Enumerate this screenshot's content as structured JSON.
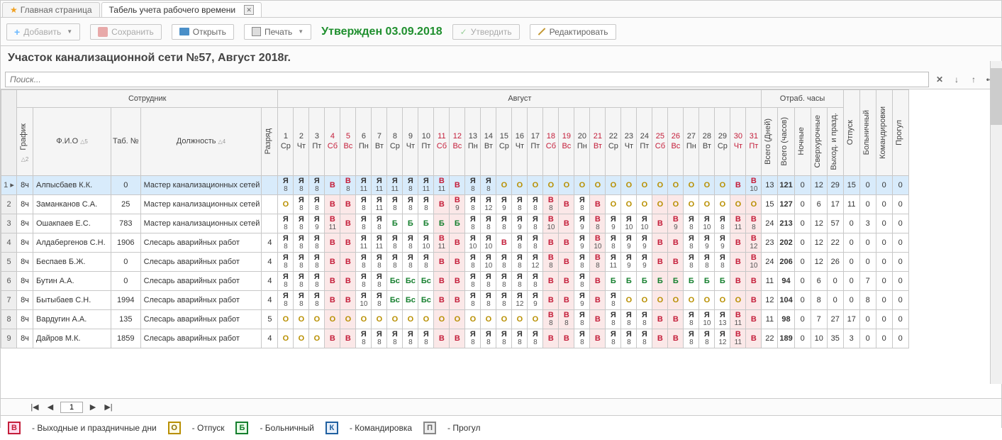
{
  "tabs": {
    "home": "Главная страница",
    "timesheet": "Табель учета рабочего времени"
  },
  "toolbar": {
    "add": "Добавить",
    "save": "Сохранить",
    "open": "Открыть",
    "print": "Печать",
    "approved_text": "Утвержден 03.09.2018",
    "approve": "Утвердить",
    "edit": "Редактировать"
  },
  "title": "Участок канализационной сети №57, Август 2018г.",
  "search": {
    "placeholder": "Поиск..."
  },
  "headers": {
    "employee": "Сотрудник",
    "schedule": "График",
    "fio": "Ф.И.О",
    "tabnum": "Таб. №",
    "position": "Должность",
    "grade": "Разряд",
    "month": "Август",
    "worked_hours": "Отраб. часы",
    "total_days": "Bcero (Дней)",
    "total_hours": "Bcero (часов)",
    "night": "Ночные",
    "overtime": "Сверхурочные",
    "holidays": "Выход. и празд.",
    "vacation": "Отпуск",
    "sick": "Больничный",
    "trip": "Командировки",
    "absence": "Прогул"
  },
  "days": [
    {
      "n": "1",
      "w": "Ср",
      "wk": 0
    },
    {
      "n": "2",
      "w": "Чт",
      "wk": 0
    },
    {
      "n": "3",
      "w": "Пт",
      "wk": 0
    },
    {
      "n": "4",
      "w": "Сб",
      "wk": 1
    },
    {
      "n": "5",
      "w": "Вс",
      "wk": 1
    },
    {
      "n": "6",
      "w": "Пн",
      "wk": 0
    },
    {
      "n": "7",
      "w": "Вт",
      "wk": 0
    },
    {
      "n": "8",
      "w": "Ср",
      "wk": 0
    },
    {
      "n": "9",
      "w": "Чт",
      "wk": 0
    },
    {
      "n": "10",
      "w": "Пт",
      "wk": 0
    },
    {
      "n": "11",
      "w": "Сб",
      "wk": 1
    },
    {
      "n": "12",
      "w": "Вс",
      "wk": 1
    },
    {
      "n": "13",
      "w": "Пн",
      "wk": 0
    },
    {
      "n": "14",
      "w": "Вт",
      "wk": 0
    },
    {
      "n": "15",
      "w": "Ср",
      "wk": 0
    },
    {
      "n": "16",
      "w": "Чт",
      "wk": 0
    },
    {
      "n": "17",
      "w": "Пт",
      "wk": 0
    },
    {
      "n": "18",
      "w": "Сб",
      "wk": 1
    },
    {
      "n": "19",
      "w": "Вс",
      "wk": 1
    },
    {
      "n": "20",
      "w": "Пн",
      "wk": 0
    },
    {
      "n": "21",
      "w": "Вт",
      "wk": 1
    },
    {
      "n": "22",
      "w": "Ср",
      "wk": 0
    },
    {
      "n": "23",
      "w": "Чт",
      "wk": 0
    },
    {
      "n": "24",
      "w": "Пт",
      "wk": 0
    },
    {
      "n": "25",
      "w": "Сб",
      "wk": 1
    },
    {
      "n": "26",
      "w": "Вс",
      "wk": 1
    },
    {
      "n": "27",
      "w": "Пн",
      "wk": 0
    },
    {
      "n": "28",
      "w": "Вт",
      "wk": 0
    },
    {
      "n": "29",
      "w": "Ср",
      "wk": 0
    },
    {
      "n": "30",
      "w": "Чт",
      "wk": 1
    },
    {
      "n": "31",
      "w": "Пт",
      "wk": 1
    }
  ],
  "rows": [
    {
      "n": 1,
      "sel": 1,
      "sched": "8ч",
      "fio": "Алпысбаев К.К.",
      "tab": "0",
      "pos": "Мастер канализационных сетей",
      "grade": "",
      "cells": [
        [
          "Я",
          "8"
        ],
        [
          "Я",
          "8"
        ],
        [
          "Я",
          "8"
        ],
        [
          "В",
          ""
        ],
        [
          "В",
          "8"
        ],
        [
          "Я",
          "11"
        ],
        [
          "Я",
          "11"
        ],
        [
          "Я",
          "11"
        ],
        [
          "Я",
          "8"
        ],
        [
          "Я",
          "11"
        ],
        [
          "В",
          "11"
        ],
        [
          "В",
          ""
        ],
        [
          "Я",
          "8"
        ],
        [
          "Я",
          "8"
        ],
        [
          "О",
          ""
        ],
        [
          "О",
          ""
        ],
        [
          "О",
          ""
        ],
        [
          "О",
          ""
        ],
        [
          "О",
          ""
        ],
        [
          "О",
          ""
        ],
        [
          "О",
          ""
        ],
        [
          "О",
          ""
        ],
        [
          "О",
          ""
        ],
        [
          "О",
          ""
        ],
        [
          "О",
          ""
        ],
        [
          "О",
          ""
        ],
        [
          "О",
          ""
        ],
        [
          "О",
          ""
        ],
        [
          "О",
          ""
        ],
        [
          "В",
          ""
        ],
        [
          "В",
          "10"
        ]
      ],
      "sum": [
        "13",
        "121",
        "0",
        "12",
        "29",
        "15",
        "0",
        "0",
        "0"
      ]
    },
    {
      "n": 2,
      "sched": "8ч",
      "fio": "Заманканов С.А.",
      "tab": "25",
      "pos": "Мастер канализационных сетей",
      "grade": "",
      "cells": [
        [
          "О",
          ""
        ],
        [
          "Я",
          "8"
        ],
        [
          "Я",
          "8"
        ],
        [
          "В",
          ""
        ],
        [
          "В",
          ""
        ],
        [
          "Я",
          "8"
        ],
        [
          "Я",
          "11"
        ],
        [
          "Я",
          "8"
        ],
        [
          "Я",
          "8"
        ],
        [
          "Я",
          "8"
        ],
        [
          "В",
          ""
        ],
        [
          "В",
          "9"
        ],
        [
          "Я",
          "8"
        ],
        [
          "Я",
          "12"
        ],
        [
          "Я",
          "9"
        ],
        [
          "Я",
          "8"
        ],
        [
          "Я",
          "8"
        ],
        [
          "В",
          "8"
        ],
        [
          "В",
          ""
        ],
        [
          "Я",
          "8"
        ],
        [
          "В",
          ""
        ],
        [
          "О",
          ""
        ],
        [
          "О",
          ""
        ],
        [
          "О",
          ""
        ],
        [
          "О",
          ""
        ],
        [
          "О",
          ""
        ],
        [
          "О",
          ""
        ],
        [
          "О",
          ""
        ],
        [
          "О",
          ""
        ],
        [
          "О",
          ""
        ],
        [
          "О",
          ""
        ]
      ],
      "sum": [
        "15",
        "127",
        "0",
        "6",
        "17",
        "11",
        "0",
        "0",
        "0"
      ]
    },
    {
      "n": 3,
      "sched": "8ч",
      "fio": "Ошакпаев Е.С.",
      "tab": "783",
      "pos": "Мастер канализационных сетей",
      "grade": "",
      "cells": [
        [
          "Я",
          "8"
        ],
        [
          "Я",
          "8"
        ],
        [
          "Я",
          "9"
        ],
        [
          "В",
          "11"
        ],
        [
          "В",
          ""
        ],
        [
          "Я",
          "8"
        ],
        [
          "Я",
          "8"
        ],
        [
          "Б",
          ""
        ],
        [
          "Б",
          ""
        ],
        [
          "Б",
          ""
        ],
        [
          "Б",
          ""
        ],
        [
          "Б",
          ""
        ],
        [
          "Я",
          "8"
        ],
        [
          "Я",
          "8"
        ],
        [
          "Я",
          "8"
        ],
        [
          "Я",
          "9"
        ],
        [
          "Я",
          "8"
        ],
        [
          "В",
          "10"
        ],
        [
          "В",
          ""
        ],
        [
          "Я",
          "9"
        ],
        [
          "В",
          "8"
        ],
        [
          "Я",
          "9"
        ],
        [
          "Я",
          "10"
        ],
        [
          "Я",
          "10"
        ],
        [
          "В",
          ""
        ],
        [
          "В",
          "9"
        ],
        [
          "Я",
          "8"
        ],
        [
          "Я",
          "10"
        ],
        [
          "Я",
          "8"
        ],
        [
          "В",
          "11"
        ],
        [
          "В",
          "8"
        ]
      ],
      "sum": [
        "24",
        "213",
        "0",
        "12",
        "57",
        "0",
        "3",
        "0",
        "0"
      ]
    },
    {
      "n": 4,
      "sched": "8ч",
      "fio": "Алдабергенов С.Н.",
      "tab": "1906",
      "pos": "Слесарь аварийных работ",
      "grade": "4",
      "cells": [
        [
          "Я",
          "8"
        ],
        [
          "Я",
          "8"
        ],
        [
          "Я",
          "8"
        ],
        [
          "В",
          ""
        ],
        [
          "В",
          ""
        ],
        [
          "Я",
          "11"
        ],
        [
          "Я",
          "11"
        ],
        [
          "Я",
          "8"
        ],
        [
          "Я",
          "8"
        ],
        [
          "Я",
          "10"
        ],
        [
          "В",
          "11"
        ],
        [
          "В",
          ""
        ],
        [
          "Я",
          "10"
        ],
        [
          "Я",
          "10"
        ],
        [
          "В",
          ""
        ],
        [
          "Я",
          "8"
        ],
        [
          "Я",
          "8"
        ],
        [
          "В",
          ""
        ],
        [
          "В",
          ""
        ],
        [
          "Я",
          "9"
        ],
        [
          "В",
          "10"
        ],
        [
          "Я",
          "8"
        ],
        [
          "Я",
          "9"
        ],
        [
          "Я",
          "9"
        ],
        [
          "В",
          ""
        ],
        [
          "В",
          ""
        ],
        [
          "Я",
          "8"
        ],
        [
          "Я",
          "9"
        ],
        [
          "Я",
          "9"
        ],
        [
          "В",
          ""
        ],
        [
          "В",
          "12"
        ]
      ],
      "sum": [
        "23",
        "202",
        "0",
        "12",
        "22",
        "0",
        "0",
        "0",
        "0"
      ]
    },
    {
      "n": 5,
      "sched": "8ч",
      "fio": "Беспаев Б.Ж.",
      "tab": "0",
      "pos": "Слесарь аварийных работ",
      "grade": "4",
      "cells": [
        [
          "Я",
          "8"
        ],
        [
          "Я",
          "8"
        ],
        [
          "Я",
          "8"
        ],
        [
          "В",
          ""
        ],
        [
          "В",
          ""
        ],
        [
          "Я",
          "8"
        ],
        [
          "Я",
          "8"
        ],
        [
          "Я",
          "8"
        ],
        [
          "Я",
          "8"
        ],
        [
          "Я",
          "8"
        ],
        [
          "В",
          ""
        ],
        [
          "В",
          ""
        ],
        [
          "Я",
          "8"
        ],
        [
          "Я",
          "10"
        ],
        [
          "Я",
          "8"
        ],
        [
          "Я",
          "8"
        ],
        [
          "Я",
          "12"
        ],
        [
          "В",
          "8"
        ],
        [
          "В",
          ""
        ],
        [
          "Я",
          "8"
        ],
        [
          "В",
          "8"
        ],
        [
          "Я",
          "11"
        ],
        [
          "Я",
          "9"
        ],
        [
          "Я",
          "9"
        ],
        [
          "В",
          ""
        ],
        [
          "В",
          ""
        ],
        [
          "Я",
          "8"
        ],
        [
          "Я",
          "8"
        ],
        [
          "Я",
          "8"
        ],
        [
          "В",
          ""
        ],
        [
          "В",
          "10"
        ]
      ],
      "sum": [
        "24",
        "206",
        "0",
        "12",
        "26",
        "0",
        "0",
        "0",
        "0"
      ]
    },
    {
      "n": 6,
      "sched": "8ч",
      "fio": "Бутин А.А.",
      "tab": "0",
      "pos": "Слесарь аварийных работ",
      "grade": "4",
      "cells": [
        [
          "Я",
          "8"
        ],
        [
          "Я",
          "8"
        ],
        [
          "Я",
          "8"
        ],
        [
          "В",
          ""
        ],
        [
          "В",
          ""
        ],
        [
          "Я",
          "8"
        ],
        [
          "Я",
          "8"
        ],
        [
          "Бс",
          ""
        ],
        [
          "Бс",
          ""
        ],
        [
          "Бс",
          ""
        ],
        [
          "В",
          ""
        ],
        [
          "В",
          ""
        ],
        [
          "Я",
          "8"
        ],
        [
          "Я",
          "8"
        ],
        [
          "Я",
          "8"
        ],
        [
          "Я",
          "8"
        ],
        [
          "Я",
          "8"
        ],
        [
          "В",
          ""
        ],
        [
          "В",
          ""
        ],
        [
          "Я",
          "8"
        ],
        [
          "В",
          ""
        ],
        [
          "Б",
          ""
        ],
        [
          "Б",
          ""
        ],
        [
          "Б",
          ""
        ],
        [
          "Б",
          ""
        ],
        [
          "Б",
          ""
        ],
        [
          "Б",
          ""
        ],
        [
          "Б",
          ""
        ],
        [
          "Б",
          ""
        ],
        [
          "В",
          ""
        ],
        [
          "В",
          ""
        ]
      ],
      "sum": [
        "11",
        "94",
        "0",
        "6",
        "0",
        "0",
        "7",
        "0",
        "0"
      ]
    },
    {
      "n": 7,
      "sched": "8ч",
      "fio": "Бытыбаев С.Н.",
      "tab": "1994",
      "pos": "Слесарь аварийных работ",
      "grade": "4",
      "cells": [
        [
          "Я",
          "8"
        ],
        [
          "Я",
          "8"
        ],
        [
          "Я",
          "8"
        ],
        [
          "В",
          ""
        ],
        [
          "В",
          ""
        ],
        [
          "Я",
          "10"
        ],
        [
          "Я",
          "8"
        ],
        [
          "Бс",
          ""
        ],
        [
          "Бс",
          ""
        ],
        [
          "Бс",
          ""
        ],
        [
          "В",
          ""
        ],
        [
          "В",
          ""
        ],
        [
          "Я",
          "8"
        ],
        [
          "Я",
          "8"
        ],
        [
          "Я",
          "8"
        ],
        [
          "Я",
          "12"
        ],
        [
          "Я",
          "9"
        ],
        [
          "В",
          ""
        ],
        [
          "В",
          ""
        ],
        [
          "Я",
          "9"
        ],
        [
          "В",
          ""
        ],
        [
          "Я",
          "8"
        ],
        [
          "О",
          ""
        ],
        [
          "О",
          ""
        ],
        [
          "О",
          ""
        ],
        [
          "О",
          ""
        ],
        [
          "О",
          ""
        ],
        [
          "О",
          ""
        ],
        [
          "О",
          ""
        ],
        [
          "О",
          ""
        ],
        [
          "В",
          ""
        ]
      ],
      "sum": [
        "12",
        "104",
        "0",
        "8",
        "0",
        "0",
        "8",
        "0",
        "0"
      ]
    },
    {
      "n": 8,
      "sched": "8ч",
      "fio": "Вардугин А.А.",
      "tab": "135",
      "pos": "Слесарь аварийных работ",
      "grade": "5",
      "cells": [
        [
          "О",
          ""
        ],
        [
          "О",
          ""
        ],
        [
          "О",
          ""
        ],
        [
          "О",
          ""
        ],
        [
          "О",
          ""
        ],
        [
          "О",
          ""
        ],
        [
          "О",
          ""
        ],
        [
          "О",
          ""
        ],
        [
          "О",
          ""
        ],
        [
          "О",
          ""
        ],
        [
          "О",
          ""
        ],
        [
          "О",
          ""
        ],
        [
          "О",
          ""
        ],
        [
          "О",
          ""
        ],
        [
          "О",
          ""
        ],
        [
          "О",
          ""
        ],
        [
          "О",
          ""
        ],
        [
          "В",
          "8"
        ],
        [
          "В",
          "8"
        ],
        [
          "Я",
          "8"
        ],
        [
          "В",
          ""
        ],
        [
          "Я",
          "8"
        ],
        [
          "Я",
          "8"
        ],
        [
          "Я",
          "8"
        ],
        [
          "В",
          ""
        ],
        [
          "В",
          ""
        ],
        [
          "Я",
          "8"
        ],
        [
          "Я",
          "10"
        ],
        [
          "Я",
          "13"
        ],
        [
          "В",
          "11"
        ],
        [
          "В",
          ""
        ]
      ],
      "sum": [
        "11",
        "98",
        "0",
        "7",
        "27",
        "17",
        "0",
        "0",
        "0"
      ]
    },
    {
      "n": 9,
      "sched": "8ч",
      "fio": "Дайров М.К.",
      "tab": "1859",
      "pos": "Слесарь аварийных работ",
      "grade": "4",
      "cells": [
        [
          "О",
          ""
        ],
        [
          "О",
          ""
        ],
        [
          "О",
          ""
        ],
        [
          "В",
          ""
        ],
        [
          "В",
          ""
        ],
        [
          "Я",
          "8"
        ],
        [
          "Я",
          "8"
        ],
        [
          "Я",
          "8"
        ],
        [
          "Я",
          "8"
        ],
        [
          "Я",
          "8"
        ],
        [
          "В",
          ""
        ],
        [
          "В",
          ""
        ],
        [
          "Я",
          "8"
        ],
        [
          "Я",
          "8"
        ],
        [
          "Я",
          "8"
        ],
        [
          "Я",
          "8"
        ],
        [
          "Я",
          "8"
        ],
        [
          "В",
          ""
        ],
        [
          "В",
          ""
        ],
        [
          "Я",
          "8"
        ],
        [
          "В",
          ""
        ],
        [
          "Я",
          "8"
        ],
        [
          "Я",
          "8"
        ],
        [
          "Я",
          "8"
        ],
        [
          "В",
          ""
        ],
        [
          "В",
          ""
        ],
        [
          "Я",
          "8"
        ],
        [
          "Я",
          "8"
        ],
        [
          "Я",
          "12"
        ],
        [
          "В",
          "11"
        ],
        [
          "В",
          ""
        ]
      ],
      "sum": [
        "22",
        "189",
        "0",
        "10",
        "35",
        "3",
        "0",
        "0",
        "0"
      ]
    }
  ],
  "pager": {
    "page": "1"
  },
  "legend": {
    "B": "- Выходные и праздничные дни",
    "O": "- Отпуск",
    "Bl": "- Больничный",
    "K": "- Командировка",
    "P": "- Прогул"
  }
}
